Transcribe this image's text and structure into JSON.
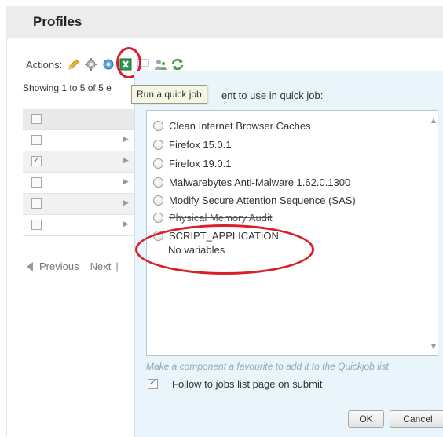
{
  "header": {
    "title": "Profiles"
  },
  "actions": {
    "label": "Actions:",
    "icons": [
      "pencil-icon",
      "gear-icon",
      "quick-job-icon",
      "excel-icon",
      "comment-icon",
      "users-icon",
      "refresh-icon"
    ]
  },
  "showing": "Showing 1 to 5 of 5 e",
  "tooltip": "Run a quick job",
  "grid": {
    "rows": [
      {
        "checked": false,
        "header": true
      },
      {
        "checked": false
      },
      {
        "checked": true
      },
      {
        "checked": false
      },
      {
        "checked": false
      },
      {
        "checked": false
      }
    ]
  },
  "pager": {
    "previous": "Previous",
    "next": "Next",
    "sep": "|"
  },
  "dialog": {
    "instruction": "ent to use in quick job:",
    "options": [
      "Clean Internet Browser Caches",
      "Firefox 15.0.1",
      "Firefox 19.0.1",
      "Malwarebytes Anti-Malware 1.62.0.1300",
      "Modify Secure Attention Sequence (SAS)",
      "Physical Memory Audit",
      "SCRIPT_APPLICATION"
    ],
    "option_sub": "No variables",
    "hint": "Make a component a favourite to add it to the Quickjob list",
    "follow_label": "Follow to jobs list page on submit",
    "ok_label": "OK",
    "cancel_label": "Cancel"
  },
  "colors": {
    "annotation": "#d8202a",
    "dialog_bg": "#eaf4fb",
    "header_bg": "#ececec"
  }
}
